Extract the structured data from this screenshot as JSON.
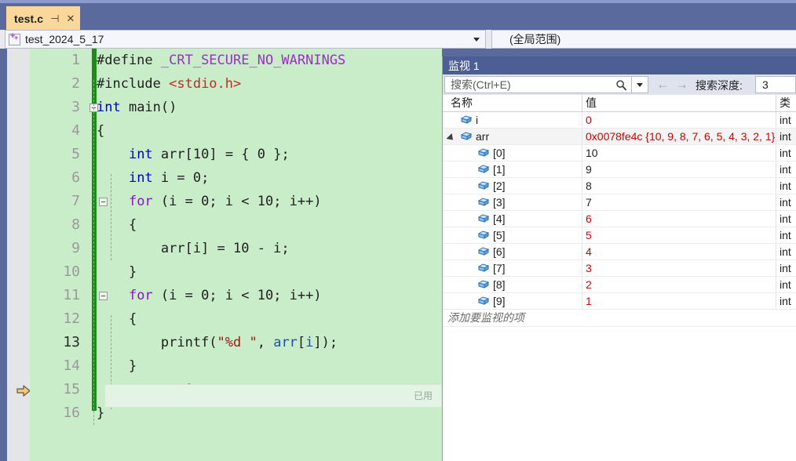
{
  "window": {
    "tab": {
      "label": "test.c",
      "pin_icon": "pin-icon",
      "close_icon": "close-icon"
    }
  },
  "navbar": {
    "project_name": "test_2024_5_17",
    "scope": "(全局范围)"
  },
  "editor": {
    "current_line": 13,
    "exec_marker": "execution-pointer-arrow",
    "inline_hint": "已用",
    "line_numbers": [
      "1",
      "2",
      "3",
      "4",
      "5",
      "6",
      "7",
      "8",
      "9",
      "10",
      "11",
      "12",
      "13",
      "14",
      "15",
      "16"
    ],
    "lines": [
      {
        "n": 1,
        "tokens": [
          {
            "t": "#define ",
            "c": "plain"
          },
          {
            "t": "_CRT_SECURE_NO_WARNINGS",
            "c": "pp"
          }
        ]
      },
      {
        "n": 2,
        "tokens": [
          {
            "t": "#include ",
            "c": "plain"
          },
          {
            "t": "<stdio.h>",
            "c": "hdr"
          }
        ]
      },
      {
        "n": 3,
        "tokens": [
          {
            "t": "int",
            "c": "kw"
          },
          {
            "t": " main()",
            "c": "plain"
          }
        ]
      },
      {
        "n": 4,
        "tokens": [
          {
            "t": "{",
            "c": "plain"
          }
        ]
      },
      {
        "n": 5,
        "tokens": [
          {
            "t": "    ",
            "c": "plain"
          },
          {
            "t": "int",
            "c": "kw"
          },
          {
            "t": " arr[",
            "c": "plain"
          },
          {
            "t": "10",
            "c": "num"
          },
          {
            "t": "] = { ",
            "c": "plain"
          },
          {
            "t": "0",
            "c": "num"
          },
          {
            "t": " };",
            "c": "plain"
          }
        ]
      },
      {
        "n": 6,
        "tokens": [
          {
            "t": "    ",
            "c": "plain"
          },
          {
            "t": "int",
            "c": "kw"
          },
          {
            "t": " i = ",
            "c": "plain"
          },
          {
            "t": "0",
            "c": "num"
          },
          {
            "t": ";",
            "c": "plain"
          }
        ]
      },
      {
        "n": 7,
        "tokens": [
          {
            "t": "    ",
            "c": "plain"
          },
          {
            "t": "for",
            "c": "kw2"
          },
          {
            "t": " (i = 0; i < 10; i++)",
            "c": "plain"
          }
        ]
      },
      {
        "n": 8,
        "tokens": [
          {
            "t": "    {",
            "c": "plain"
          }
        ]
      },
      {
        "n": 9,
        "tokens": [
          {
            "t": "        arr[i] = 10 - i;",
            "c": "plain"
          }
        ]
      },
      {
        "n": 10,
        "tokens": [
          {
            "t": "    }",
            "c": "plain"
          }
        ]
      },
      {
        "n": 11,
        "tokens": [
          {
            "t": "    ",
            "c": "plain"
          },
          {
            "t": "for",
            "c": "kw2"
          },
          {
            "t": " (i = 0; i < 10; i++)",
            "c": "plain"
          }
        ]
      },
      {
        "n": 12,
        "tokens": [
          {
            "t": "    {",
            "c": "plain"
          }
        ]
      },
      {
        "n": 13,
        "tokens": [
          {
            "t": "        printf(",
            "c": "plain"
          },
          {
            "t": "\"%d \"",
            "c": "str"
          },
          {
            "t": ", ",
            "c": "plain"
          },
          {
            "t": "arr",
            "c": "ident"
          },
          {
            "t": "[",
            "c": "plain"
          },
          {
            "t": "i",
            "c": "ident"
          },
          {
            "t": "]);",
            "c": "plain"
          }
        ]
      },
      {
        "n": 14,
        "tokens": [
          {
            "t": "    }",
            "c": "plain"
          }
        ]
      },
      {
        "n": 15,
        "tokens": [
          {
            "t": "    ",
            "c": "plain"
          },
          {
            "t": "return",
            "c": "kw2"
          },
          {
            "t": " 0;",
            "c": "plain"
          }
        ]
      },
      {
        "n": 16,
        "tokens": [
          {
            "t": "}",
            "c": "plain"
          }
        ]
      }
    ]
  },
  "watch": {
    "title": "监视 1",
    "search_placeholder": "搜索(Ctrl+E)",
    "search_value": "",
    "search_icon": "search-icon",
    "back_arrow": "←",
    "forward_arrow": "→",
    "depth_label": "搜索深度:",
    "depth_value": "3",
    "columns": [
      "名称",
      "值",
      "类型"
    ],
    "column_type_clipped": "类",
    "add_placeholder": "添加要监视的项",
    "rows": [
      {
        "name": "i",
        "value": "0",
        "type": "int",
        "value_color": "red",
        "indent": 0,
        "expandable": false,
        "expanded": false,
        "alt": false
      },
      {
        "name": "arr",
        "value": "0x0078fe4c {10, 9, 8, 7, 6, 5, 4, 3, 2, 1}",
        "type": "int",
        "value_color": "red",
        "indent": 0,
        "expandable": true,
        "expanded": true,
        "alt": true
      },
      {
        "name": "[0]",
        "value": "10",
        "type": "int",
        "value_color": "black",
        "indent": 1,
        "expandable": false,
        "expanded": false,
        "alt": false
      },
      {
        "name": "[1]",
        "value": "9",
        "type": "int",
        "value_color": "black",
        "indent": 1,
        "expandable": false,
        "expanded": false,
        "alt": false
      },
      {
        "name": "[2]",
        "value": "8",
        "type": "int",
        "value_color": "black",
        "indent": 1,
        "expandable": false,
        "expanded": false,
        "alt": false
      },
      {
        "name": "[3]",
        "value": "7",
        "type": "int",
        "value_color": "black",
        "indent": 1,
        "expandable": false,
        "expanded": false,
        "alt": false
      },
      {
        "name": "[4]",
        "value": "6",
        "type": "int",
        "value_color": "red",
        "indent": 1,
        "expandable": false,
        "expanded": false,
        "alt": false
      },
      {
        "name": "[5]",
        "value": "5",
        "type": "int",
        "value_color": "red",
        "indent": 1,
        "expandable": false,
        "expanded": false,
        "alt": false
      },
      {
        "name": "[6]",
        "value": "4",
        "type": "int",
        "value_color": "red",
        "indent": 1,
        "expandable": false,
        "expanded": false,
        "alt": false
      },
      {
        "name": "[7]",
        "value": "3",
        "type": "int",
        "value_color": "red",
        "indent": 1,
        "expandable": false,
        "expanded": false,
        "alt": false
      },
      {
        "name": "[8]",
        "value": "2",
        "type": "int",
        "value_color": "red",
        "indent": 1,
        "expandable": false,
        "expanded": false,
        "alt": false
      },
      {
        "name": "[9]",
        "value": "1",
        "type": "int",
        "value_color": "red",
        "indent": 1,
        "expandable": false,
        "expanded": false,
        "alt": false
      }
    ]
  },
  "colors": {
    "chrome_blue": "#5b6a9c",
    "tab_active": "#fcd79a",
    "editor_bg": "#c9ecc9",
    "gutter_bg": "#e4e5e7",
    "watch_title_bg": "#4c5f92",
    "change_bar_green": "#1c8a1c",
    "value_modified_red": "#cc0000",
    "keyword_blue": "#0000d0",
    "keyword_purple": "#8a16c0",
    "string_red": "#a31515"
  }
}
